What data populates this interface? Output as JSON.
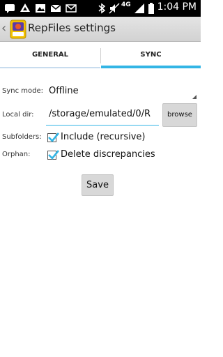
{
  "status_bar": {
    "time": "1:04 PM",
    "icons": [
      "sms-icon",
      "drive-icon",
      "gallery-icon",
      "gmail-icon",
      "envelope-icon",
      "bluetooth-icon",
      "silent-icon",
      "4g-icon",
      "signal-icon",
      "battery-icon"
    ],
    "network_label": "4G"
  },
  "action_bar": {
    "title": "RepFiles settings"
  },
  "tabs": [
    {
      "label": "GENERAL",
      "selected": false
    },
    {
      "label": "SYNC",
      "selected": true
    }
  ],
  "form": {
    "sync_mode_label": "Sync mode:",
    "sync_mode_value": "Offline",
    "local_dir_label": "Local dir:",
    "local_dir_value": "/storage/emulated/0/R",
    "browse_label": "browse",
    "subfolders_label": "Subfolders:",
    "subfolders_option": "Include (recursive)",
    "subfolders_checked": true,
    "orphan_label": "Orphan:",
    "orphan_option": "Delete discrepancies",
    "orphan_checked": true,
    "save_label": "Save"
  },
  "colors": {
    "accent": "#33b5e5",
    "status_bar_bg": "#000000",
    "action_bar_bg": "#dcdcdc",
    "button_bg": "#d8d8d8"
  }
}
